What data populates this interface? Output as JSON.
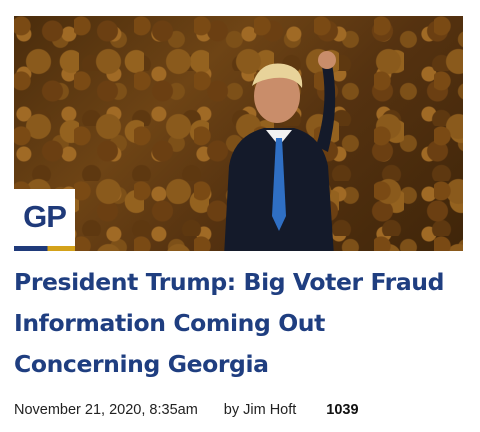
{
  "logo": {
    "text": "GP"
  },
  "article": {
    "headline": "President Trump: Big Voter Fraud Information Coming Out Concerning Georgia",
    "date": "November 21, 2020, 8:35am",
    "author": "by Jim Hoft",
    "comment_count": "1039"
  },
  "colors": {
    "headline": "#1f3e80",
    "logo_blue": "#1f3a7a",
    "logo_gold": "#d4a21a"
  }
}
